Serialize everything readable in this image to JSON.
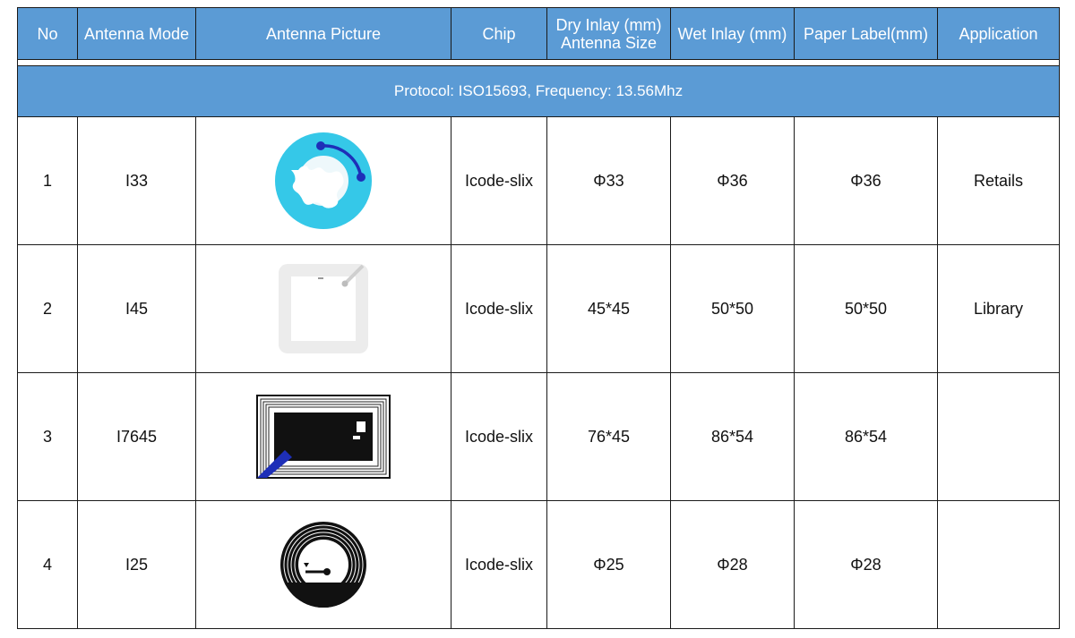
{
  "table": {
    "headers": [
      {
        "label": "No"
      },
      {
        "label": "Antenna Mode"
      },
      {
        "label": "Antenna Picture"
      },
      {
        "label": "Chip"
      },
      {
        "line1": "Dry Inlay (mm)",
        "line2": "Antenna Size"
      },
      {
        "label": "Wet Inlay (mm)"
      },
      {
        "label": "Paper Label(mm)"
      },
      {
        "label": "Application"
      }
    ],
    "protocol": "Protocol: ISO15693, Frequency: 13.56Mhz",
    "rows": [
      {
        "no": "1",
        "mode": "I33",
        "picture_icon": "round-blue-antenna-icon",
        "chip": "Icode-slix",
        "dry": "Φ33",
        "wet": "Φ36",
        "paper": "Φ36",
        "application": "Retails"
      },
      {
        "no": "2",
        "mode": "I45",
        "picture_icon": "square-grey-antenna-icon",
        "chip": "Icode-slix",
        "dry": "45*45",
        "wet": "50*50",
        "paper": "50*50",
        "application": "Library"
      },
      {
        "no": "3",
        "mode": "I7645",
        "picture_icon": "rectangular-black-antenna-icon",
        "chip": "Icode-slix",
        "dry": "76*45",
        "wet": "86*54",
        "paper": "86*54",
        "application": ""
      },
      {
        "no": "4",
        "mode": "I25",
        "picture_icon": "round-black-coil-antenna-icon",
        "chip": "Icode-slix",
        "dry": "Φ25",
        "wet": "Φ28",
        "paper": "Φ28",
        "application": ""
      }
    ]
  },
  "colors": {
    "header_bg": "#5b9bd5",
    "header_text": "#ffffff",
    "antenna_blue": "#35c8e8",
    "border": "#1a1a1a"
  }
}
